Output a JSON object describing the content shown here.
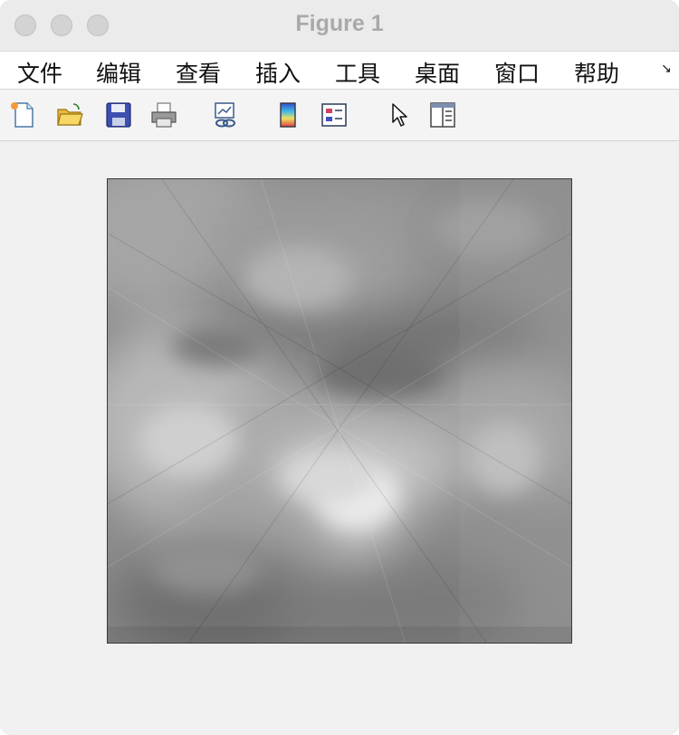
{
  "window": {
    "title": "Figure 1"
  },
  "menu": {
    "items": [
      {
        "label": "文件"
      },
      {
        "label": "编辑"
      },
      {
        "label": "查看"
      },
      {
        "label": "插入"
      },
      {
        "label": "工具"
      },
      {
        "label": "桌面"
      },
      {
        "label": "窗口"
      },
      {
        "label": "帮助"
      }
    ],
    "overflow_icon": "overflow-arrow-icon"
  },
  "toolbar": {
    "tools": [
      {
        "icon": "new-figure-icon"
      },
      {
        "icon": "open-file-icon"
      },
      {
        "icon": "save-icon"
      },
      {
        "icon": "print-icon"
      },
      {
        "icon": "link-plot-icon"
      },
      {
        "icon": "insert-colorbar-icon"
      },
      {
        "icon": "insert-legend-icon"
      },
      {
        "icon": "pointer-icon"
      },
      {
        "icon": "property-inspector-icon"
      }
    ]
  },
  "figure": {
    "content": "grayscale-image",
    "colormap": "gray"
  },
  "colors": {
    "window_bg": "#f0f0f0",
    "titlebar_bg": "#ebebeb",
    "title_text": "#a9a9a9",
    "menubar_bg": "#ffffff"
  }
}
